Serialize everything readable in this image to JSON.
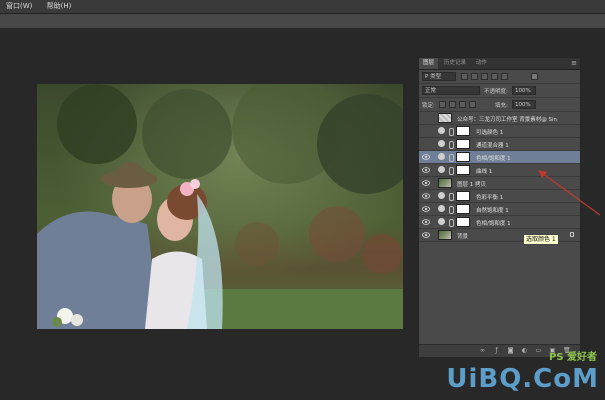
{
  "menu": {
    "items": [
      "窗口(W)",
      "帮助(H)"
    ]
  },
  "panel": {
    "tabs": [
      "图层",
      "历史记录",
      "动作"
    ],
    "filter": {
      "kind": "P 类型",
      "selected": ""
    },
    "blend": {
      "mode": "正常",
      "opacity_label": "不透明度:",
      "opacity": "100%"
    },
    "lock": {
      "label": "锁定:",
      "fill_label": "填充:",
      "fill": "100%"
    },
    "layers": [
      {
        "name": "公众号：三龙刀司工作室   背景素材@  Sinc...",
        "type": "text",
        "visible": false
      },
      {
        "name": "可选颜色 1",
        "type": "adjustment",
        "visible": false
      },
      {
        "name": "通道混合器 1",
        "type": "adjustment",
        "visible": false
      },
      {
        "name": "色相/饱和度 1",
        "type": "adjustment",
        "visible": true,
        "selected": true
      },
      {
        "name": "曲线 1",
        "type": "adjustment",
        "visible": true
      },
      {
        "name": "图层 1 拷贝",
        "type": "photo",
        "visible": true
      },
      {
        "name": "色彩平衡 1",
        "type": "adjustment",
        "visible": true
      },
      {
        "name": "自然饱和度 1",
        "type": "adjustment",
        "visible": true
      },
      {
        "name": "色相/饱和度 1",
        "type": "adjustment",
        "visible": true
      },
      {
        "name": "背景",
        "type": "photo",
        "visible": true,
        "locked": true
      }
    ]
  },
  "tooltip": "选取颜色 1",
  "watermark": {
    "main": "UiBQ.CoM",
    "sub": "PS 爱好者"
  },
  "colors": {
    "selection": "#6f7f97",
    "arrow": "#c0392b",
    "panel_bg": "#4a4a4a"
  }
}
